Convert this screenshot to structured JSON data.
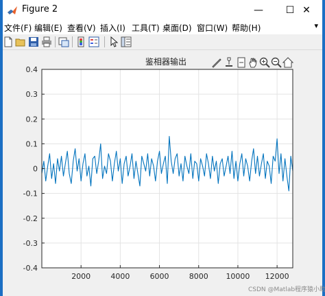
{
  "window": {
    "title": "Figure 2",
    "buttons": {
      "minimize": "—",
      "maximize": "☐",
      "close": "✕"
    }
  },
  "menu": {
    "items": [
      {
        "label": "文件(F)"
      },
      {
        "label": "编辑(E)"
      },
      {
        "label": "查看(V)"
      },
      {
        "label": "插入(I)"
      },
      {
        "label": "工具(T)"
      },
      {
        "label": "桌面(D)"
      },
      {
        "label": "窗口(W)"
      },
      {
        "label": "帮助(H)"
      }
    ],
    "overflow_icon": "chevron-icon"
  },
  "toolbar": {
    "icons": [
      "new-figure-icon",
      "open-icon",
      "save-icon",
      "print-icon",
      "link-plot-icon",
      "colorbar-icon",
      "legend-icon",
      "edit-plot-icon",
      "property-inspector-icon"
    ]
  },
  "axes_toolbar": {
    "icons": [
      "brush-icon",
      "data-tips-icon",
      "save-axes-icon",
      "pan-icon",
      "zoom-in-icon",
      "zoom-out-icon",
      "home-icon"
    ]
  },
  "watermark": "CSDN @Matlab程序猿小助手",
  "chart_data": {
    "type": "line",
    "title": "鉴相器输出",
    "xlabel": "",
    "ylabel": "",
    "xlim": [
      0,
      12800
    ],
    "ylim": [
      -0.4,
      0.4
    ],
    "xticks": [
      2000,
      4000,
      6000,
      8000,
      10000,
      12000
    ],
    "yticks": [
      -0.4,
      -0.3,
      -0.2,
      -0.1,
      0,
      0.1,
      0.2,
      0.3,
      0.4
    ],
    "ytick_labels": [
      "-0.4",
      "-0.3",
      "-0.2",
      "-0.1",
      "0",
      "0.1",
      "0.2",
      "0.3",
      "0.4"
    ],
    "xtick_labels": [
      "2000",
      "4000",
      "6000",
      "8000",
      "10000",
      "12000"
    ],
    "grid": true,
    "line_color": "#0072bd",
    "series": [
      {
        "x": [
          0,
          100,
          200,
          300,
          400,
          500,
          600,
          700,
          800,
          900,
          1000,
          1100,
          1200,
          1300,
          1400,
          1500,
          1600,
          1700,
          1800,
          1900,
          2000,
          2100,
          2200,
          2300,
          2400,
          2500,
          2600,
          2700,
          2800,
          2900,
          3000,
          3100,
          3200,
          3300,
          3400,
          3500,
          3600,
          3700,
          3800,
          3900,
          4000,
          4100,
          4200,
          4300,
          4400,
          4500,
          4600,
          4700,
          4800,
          4900,
          5000,
          5100,
          5200,
          5300,
          5400,
          5500,
          5600,
          5700,
          5800,
          5900,
          6000,
          6100,
          6200,
          6300,
          6400,
          6500,
          6600,
          6700,
          6800,
          6900,
          7000,
          7100,
          7200,
          7300,
          7400,
          7500,
          7600,
          7700,
          7800,
          7900,
          8000,
          8100,
          8200,
          8300,
          8400,
          8500,
          8600,
          8700,
          8800,
          8900,
          9000,
          9100,
          9200,
          9300,
          9400,
          9500,
          9600,
          9700,
          9800,
          9900,
          10000,
          10100,
          10200,
          10300,
          10400,
          10500,
          10600,
          10700,
          10800,
          10900,
          11000,
          11100,
          11200,
          11300,
          11400,
          11500,
          11600,
          11700,
          11800,
          11900,
          12000,
          12100,
          12200,
          12300,
          12400,
          12500,
          12600,
          12700,
          12800
        ],
        "values": [
          -0.02,
          0.03,
          -0.05,
          0.01,
          0.06,
          -0.04,
          0.02,
          -0.06,
          0.04,
          -0.01,
          0.05,
          -0.03,
          0.02,
          0.07,
          -0.02,
          -0.06,
          0.03,
          0.08,
          -0.01,
          0.04,
          -0.05,
          0.02,
          0.06,
          -0.03,
          0.01,
          -0.07,
          0.04,
          0.05,
          -0.02,
          0.03,
          0.1,
          -0.04,
          0.01,
          -0.02,
          0.06,
          0.03,
          -0.05,
          0.02,
          0.07,
          -0.01,
          0.04,
          -0.06,
          0.02,
          0.05,
          -0.03,
          0.01,
          0.06,
          -0.04,
          0.03,
          -0.02,
          -0.07,
          0.05,
          0.02,
          -0.01,
          0.06,
          -0.03,
          0.04,
          0.01,
          -0.05,
          0.03,
          0.07,
          -0.02,
          0.02,
          0.05,
          -0.06,
          0.13,
          0.03,
          -0.02,
          0.04,
          0.06,
          -0.03,
          0.02,
          -0.05,
          0.05,
          0.01,
          -0.02,
          0.06,
          -0.04,
          0.03,
          0.02,
          -0.05,
          0.04,
          0.01,
          -0.03,
          0.06,
          0.02,
          -0.04,
          0.05,
          -0.01,
          0.03,
          -0.06,
          0.02,
          0.04,
          -0.03,
          0.01,
          0.05,
          -0.02,
          0.07,
          -0.04,
          0.03,
          -0.05,
          0.02,
          0.06,
          -0.03,
          0.04,
          0.01,
          -0.05,
          0.03,
          0.08,
          -0.02,
          0.05,
          -0.03,
          0.02,
          0.06,
          -0.04,
          0.03,
          0.01,
          -0.06,
          0.05,
          0.03,
          0.12,
          -0.02,
          0.06,
          -0.05,
          0.04,
          -0.03,
          -0.09,
          0.05,
          -0.01
        ]
      }
    ]
  }
}
